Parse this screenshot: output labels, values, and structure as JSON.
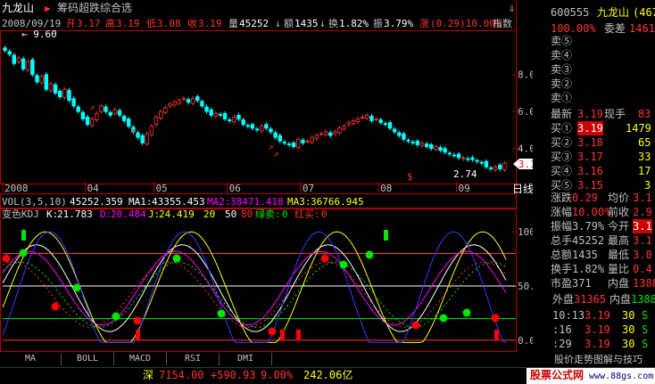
{
  "header": {
    "stock_name": "九龙山",
    "indicator_name": "筹码超跌综合选",
    "date": "2008/09/19",
    "open_label": "开",
    "open": "3.17",
    "high_label": "高",
    "high": "3.19",
    "low_label": "低",
    "low": "3.08",
    "close_label": "收",
    "close": "3.19",
    "volume_label": "量",
    "volume": "45252",
    "amount_label": "额",
    "amount": "1435",
    "turnover_label": "换",
    "turnover": "1.82%",
    "amplitude_label": "振",
    "amplitude": "3.79%",
    "change_label": "涨",
    "change": "(0.29)10.00%",
    "index_label": "指数"
  },
  "price_chart": {
    "type": "candlestick",
    "y_ticks": [
      "8.00",
      "6.00",
      "4.00"
    ],
    "y_tick_values": [
      8,
      6,
      4
    ],
    "ylim": [
      2.2,
      10.3
    ],
    "max_label": "9.60",
    "max_value": 9.6,
    "min_label": "2.74",
    "min_value": 2.74,
    "last_price_tag": "3.19",
    "x_labels": [
      "2008",
      "04",
      "05",
      "06",
      "07",
      "08",
      "09"
    ],
    "x_label_index": [
      0,
      18,
      33,
      49,
      65,
      82,
      99
    ],
    "period_label": "日线",
    "colors": {
      "up": "#ff3232",
      "down": "#00ffff"
    },
    "closes": [
      9.3,
      9.1,
      8.6,
      8.9,
      8.3,
      8.7,
      8.0,
      7.6,
      7.9,
      7.2,
      7.5,
      7.0,
      6.8,
      7.2,
      6.6,
      6.3,
      6.0,
      5.6,
      5.3,
      5.6,
      5.9,
      6.3,
      6.0,
      5.8,
      6.1,
      5.8,
      5.5,
      5.2,
      4.9,
      4.6,
      4.3,
      4.8,
      5.2,
      5.7,
      6.0,
      6.2,
      6.4,
      6.5,
      6.6,
      6.7,
      6.5,
      6.7,
      6.6,
      6.3,
      6.0,
      5.8,
      5.9,
      5.8,
      5.6,
      5.5,
      5.7,
      5.6,
      5.3,
      5.2,
      5.1,
      5.0,
      5.2,
      5.1,
      4.9,
      4.6,
      4.4,
      4.3,
      4.2,
      4.1,
      4.5,
      4.3,
      4.4,
      4.6,
      4.7,
      4.8,
      4.9,
      4.7,
      4.9,
      5.1,
      5.2,
      5.4,
      5.5,
      5.6,
      5.7,
      5.8,
      5.5,
      5.6,
      5.4,
      5.3,
      5.1,
      4.9,
      4.7,
      4.5,
      4.4,
      4.3,
      4.2,
      4.3,
      4.1,
      4.0,
      4.1,
      3.9,
      3.8,
      3.7,
      3.6,
      3.5,
      3.5,
      3.4,
      3.4,
      3.3,
      3.2,
      3.0,
      2.9,
      3.0,
      2.9,
      3.19
    ]
  },
  "volume_chart": {
    "label": "VOL(3,5,10)",
    "value": "45252.359",
    "ma1_label": "MA1:",
    "ma1": "43355.453",
    "ma2_label": "MA2:",
    "ma2": "38471.418",
    "ma3_label": "MA3:",
    "ma3": "36766.945"
  },
  "kdj_chart": {
    "label": "变色KDJ",
    "k_label": "K:",
    "k": "21.783",
    "d_label": "D:",
    "d": "20.484",
    "j_label": "J:",
    "j": "24.419",
    "ref1": "20",
    "ref2": "50",
    "ref3": "80",
    "sell_green_label": "绿卖:",
    "sell_green": "0",
    "sell_red_label": "红买:",
    "sell_red": "0",
    "y_ticks": [
      "100.00",
      "50.00",
      "0.00"
    ],
    "y_tick_values": [
      100,
      50,
      0
    ],
    "ylim": [
      -5,
      110
    ]
  },
  "tabs": [
    "MA",
    "BOLL",
    "MACD",
    "RSI",
    "DMI"
  ],
  "quote_panel": {
    "code": "600555",
    "name": "九龙山",
    "name_suffix": "(467",
    "ratio_label": "100.00%",
    "ratio_title": "委差",
    "ratio_value": "14612",
    "sell_levels": [
      "卖⑤",
      "卖④",
      "卖③",
      "卖②",
      "卖①"
    ],
    "latest_label": "最新",
    "latest": "3.19",
    "hand_label": "现手",
    "hand": "83",
    "buy_levels": [
      {
        "label": "买①",
        "price": "3.19",
        "volume": "1479"
      },
      {
        "label": "买②",
        "price": "3.18",
        "volume": "65"
      },
      {
        "label": "买③",
        "price": "3.17",
        "volume": "33"
      },
      {
        "label": "买④",
        "price": "3.16",
        "volume": "17"
      },
      {
        "label": "买⑤",
        "price": "3.15",
        "volume": "3"
      }
    ],
    "stats": [
      {
        "l1": "涨跌",
        "v1": "0.29",
        "l2": "均价",
        "v2": "3.1"
      },
      {
        "l1": "涨幅",
        "v1": "10.00%",
        "l2": "前收",
        "v2": "2.9"
      },
      {
        "l1": "振幅",
        "v1": "3.79%",
        "l2": "今开",
        "v2": "3.1"
      },
      {
        "l1": "总手",
        "v1": "45252",
        "l2": "最高",
        "v2": "3.1"
      },
      {
        "l1": "总额",
        "v1": "1435",
        "l2": "最低",
        "v2": "3.0"
      },
      {
        "l1": "换手",
        "v1": "1.82%",
        "l2": "量比",
        "v2": "0.4"
      },
      {
        "l1": "市盈",
        "v1": "371",
        "l2": "内盘",
        "v2": "1388"
      }
    ],
    "outer_label": "外盘",
    "outer": "31365",
    "inner_label": "内盘",
    "inner": "1388",
    "trades": [
      {
        "time": "10:13",
        "price": "3.19",
        "vol": "30",
        "side": "S"
      },
      {
        "time": ":16",
        "price": "3.19",
        "vol": "30",
        "side": "S"
      },
      {
        "time": ":29",
        "price": "3.19",
        "vol": "30",
        "side": "S"
      }
    ],
    "footer_text": "股价走势图解与技巧"
  },
  "status_bar": {
    "index_name": "深",
    "index_value": "7154.00",
    "index_change": "+590.93",
    "index_pct": "9.00%",
    "index_amount": "242.06亿"
  },
  "watermark": {
    "title": "股票公式网",
    "url": "www.88gs.com"
  }
}
